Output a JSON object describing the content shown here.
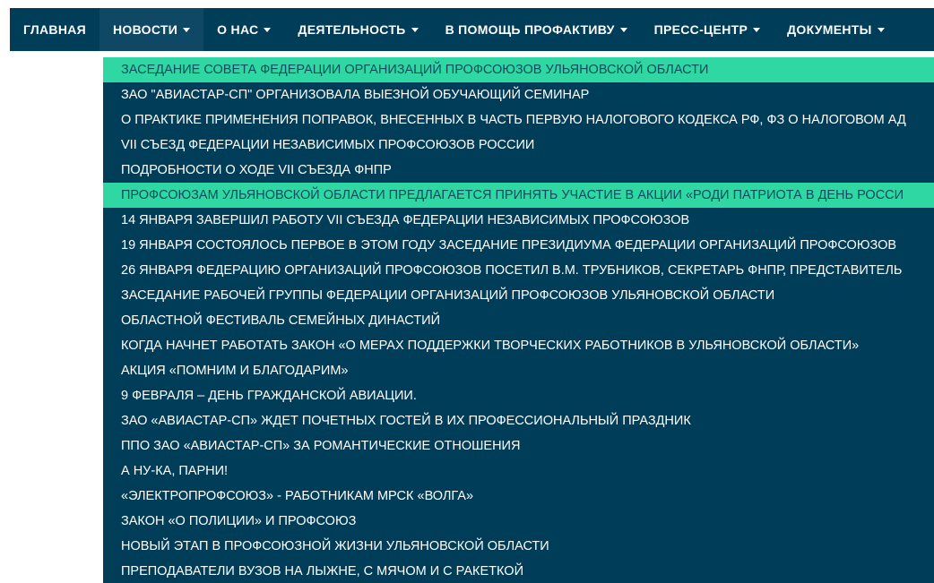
{
  "nav": {
    "items": [
      {
        "label": "ГЛАВНАЯ",
        "caret": false
      },
      {
        "label": "НОВОСТИ",
        "caret": true
      },
      {
        "label": "О НАС",
        "caret": true
      },
      {
        "label": "ДЕЯТЕЛЬНОСТЬ",
        "caret": true
      },
      {
        "label": "В ПОМОЩЬ ПРОФАКТИВУ",
        "caret": true
      },
      {
        "label": "ПРЕСС-ЦЕНТР",
        "caret": true
      },
      {
        "label": "ДОКУМЕНТЫ",
        "caret": true
      }
    ]
  },
  "dropdown": {
    "items": [
      {
        "label": "ЗАСЕДАНИЕ СОВЕТА ФЕДЕРАЦИИ ОРГАНИЗАЦИЙ ПРОФСОЮЗОВ УЛЬЯНОВСКОЙ ОБЛАСТИ",
        "highlight": true
      },
      {
        "label": "ЗАО \"АВИАСТАР-СП\" ОРГАНИЗОВАЛА ВЫЕЗНОЙ ОБУЧАЮЩИЙ СЕМИНАР",
        "highlight": false
      },
      {
        "label": "О ПРАКТИКЕ ПРИМЕНЕНИЯ ПОПРАВОК, ВНЕСЕННЫХ В ЧАСТЬ ПЕРВУЮ НАЛОГОВОГО КОДЕКСА РФ, ФЗ О НАЛОГОВОМ АД",
        "highlight": false
      },
      {
        "label": "VII СЪЕЗД ФЕДЕРАЦИИ НЕЗАВИСИМЫХ ПРОФСОЮЗОВ РОССИИ",
        "highlight": false
      },
      {
        "label": "ПОДРОБНОСТИ О ХОДЕ VII СЪЕЗДА ФНПР",
        "highlight": false
      },
      {
        "label": "ПРОФСОЮЗАМ УЛЬЯНОВСКОЙ ОБЛАСТИ ПРЕДЛАГАЕТСЯ ПРИНЯТЬ УЧАСТИЕ В АКЦИИ «РОДИ ПАТРИОТА В ДЕНЬ РОССИ",
        "highlight": true
      },
      {
        "label": "14 ЯНВАРЯ ЗАВЕРШИЛ РАБОТУ VII СЪЕЗДА ФЕДЕРАЦИИ НЕЗАВИСИМЫХ ПРОФСОЮЗОВ",
        "highlight": false
      },
      {
        "label": "19 ЯНВАРЯ СОСТОЯЛОСЬ ПЕРВОЕ В ЭТОМ ГОДУ ЗАСЕДАНИЕ ПРЕЗИДИУМА ФЕДЕРАЦИИ ОРГАНИЗАЦИЙ ПРОФСОЮЗОВ",
        "highlight": false
      },
      {
        "label": "26 ЯНВАРЯ ФЕДЕРАЦИЮ ОРГАНИЗАЦИЙ ПРОФСОЮЗОВ ПОСЕТИЛ В.М. ТРУБНИКОВ, СЕКРЕТАРЬ ФНПР, ПРЕДСТАВИТЕЛЬ",
        "highlight": false
      },
      {
        "label": "ЗАСЕДАНИЕ РАБОЧЕЙ ГРУППЫ ФЕДЕРАЦИИ ОРГАНИЗАЦИЙ ПРОФСОЮЗОВ УЛЬЯНОВСКОЙ ОБЛАСТИ",
        "highlight": false
      },
      {
        "label": "ОБЛАСТНОЙ ФЕСТИВАЛЬ СЕМЕЙНЫХ ДИНАСТИЙ",
        "highlight": false
      },
      {
        "label": "КОГДА НАЧНЕТ РАБОТАТЬ ЗАКОН «О МЕРАХ ПОДДЕРЖКИ ТВОРЧЕСКИХ РАБОТНИКОВ В УЛЬЯНОВСКОЙ ОБЛАСТИ»",
        "highlight": false
      },
      {
        "label": "АКЦИЯ «ПОМНИМ И БЛАГОДАРИМ»",
        "highlight": false
      },
      {
        "label": "9 ФЕВРАЛЯ – ДЕНЬ ГРАЖДАНСКОЙ АВИАЦИИ.",
        "highlight": false
      },
      {
        "label": "ЗАО «АВИАСТАР-СП» ЖДЕТ ПОЧЕТНЫХ ГОСТЕЙ В ИХ ПРОФЕССИОНАЛЬНЫЙ ПРАЗДНИК",
        "highlight": false
      },
      {
        "label": "ППО ЗАО «АВИАСТАР-СП» ЗА РОМАНТИЧЕСКИЕ ОТНОШЕНИЯ",
        "highlight": false
      },
      {
        "label": "А НУ-КА, ПАРНИ!",
        "highlight": false
      },
      {
        "label": "«ЭЛЕКТРОПРОФСОЮЗ» - РАБОТНИКАМ МРСК «ВОЛГА»",
        "highlight": false
      },
      {
        "label": "ЗАКОН «О ПОЛИЦИИ» И ПРОФСОЮЗ",
        "highlight": false
      },
      {
        "label": "НОВЫЙ ЭТАП В ПРОФСОЮЗНОЙ ЖИЗНИ УЛЬЯНОВСКОЙ ОБЛАСТИ",
        "highlight": false
      },
      {
        "label": "ПРЕПОДАВАТЕЛИ ВУЗОВ НА ЛЫЖНЕ, С МЯЧОМ И С РАКЕТКОЙ",
        "highlight": false
      }
    ]
  },
  "colors": {
    "nav_bg": "#003d58",
    "nav_active_bg": "#0f4864",
    "highlight_bg": "#2fd8a2",
    "highlight_text": "#0b4d5e"
  }
}
